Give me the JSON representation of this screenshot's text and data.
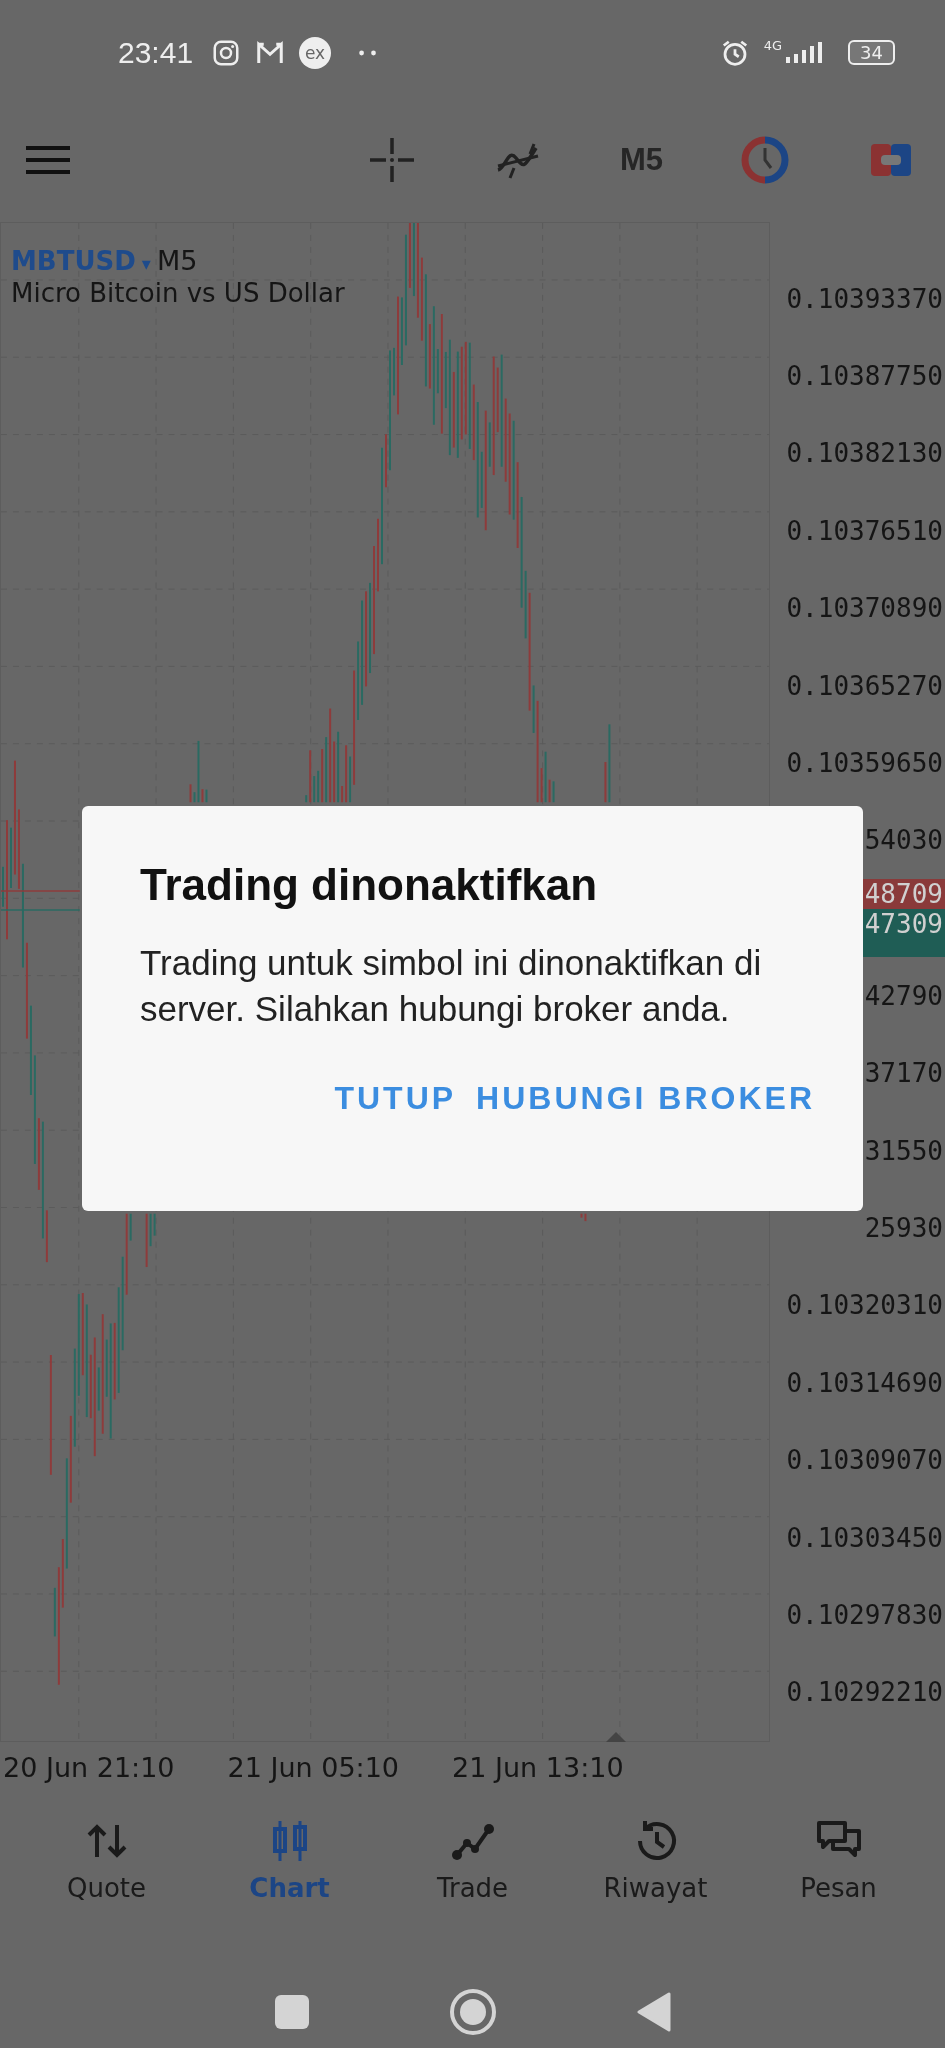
{
  "status_bar": {
    "time": "23:41",
    "app_badge": "ex",
    "network": "4G",
    "battery": "34"
  },
  "toolbar": {
    "timeframe": "M5"
  },
  "chart": {
    "symbol": "MBTUSD",
    "dropdown_mark": "▾",
    "timeframe": "M5",
    "description": "Micro Bitcoin vs US Dollar",
    "price_axis": [
      {
        "kind": "tick",
        "label": "0.10393370"
      },
      {
        "kind": "tick",
        "label": "0.10387750"
      },
      {
        "kind": "tick",
        "label": "0.10382130"
      },
      {
        "kind": "tick",
        "label": "0.10376510"
      },
      {
        "kind": "tick",
        "label": "0.10370890"
      },
      {
        "kind": "tick",
        "label": "0.10365270"
      },
      {
        "kind": "tick",
        "label": "0.10359650"
      },
      {
        "kind": "tick",
        "label": "54030"
      },
      {
        "kind": "tag",
        "label": "48709",
        "color": "#8a3a3a"
      },
      {
        "kind": "tag",
        "label": "47309",
        "color": "#1f5d55"
      },
      {
        "kind": "tick",
        "label": "42790"
      },
      {
        "kind": "tick",
        "label": "37170"
      },
      {
        "kind": "tick",
        "label": "31550"
      },
      {
        "kind": "tick",
        "label": "25930"
      },
      {
        "kind": "tick",
        "label": "0.10320310"
      },
      {
        "kind": "tick",
        "label": "0.10314690"
      },
      {
        "kind": "tick",
        "label": "0.10309070"
      },
      {
        "kind": "tick",
        "label": "0.10303450"
      },
      {
        "kind": "tick",
        "label": "0.10297830"
      },
      {
        "kind": "tick",
        "label": "0.10292210"
      }
    ],
    "time_axis": [
      "20 Jun 21:10",
      "21 Jun 05:10",
      "21 Jun 13:10"
    ]
  },
  "dialog": {
    "title": "Trading dinonaktifkan",
    "message": "Trading untuk simbol ini dinonaktifkan di server. Silahkan hubungi broker anda.",
    "buttons": [
      "TUTUP",
      "HUBUNGI BROKER"
    ]
  },
  "bottom_nav": [
    {
      "label": "Quote",
      "kind": "arrows",
      "selected": false
    },
    {
      "label": "Chart",
      "kind": "candles",
      "selected": true
    },
    {
      "label": "Trade",
      "kind": "trend",
      "selected": false
    },
    {
      "label": "Riwayat",
      "kind": "history",
      "selected": false
    },
    {
      "label": "Pesan",
      "kind": "messages",
      "selected": false
    }
  ]
}
